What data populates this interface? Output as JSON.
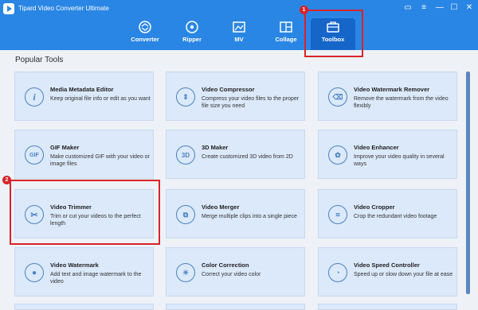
{
  "app": {
    "title": "Tipard Video Converter Ultimate"
  },
  "window_controls": [
    {
      "name": "feedback-icon",
      "glyph": "▭"
    },
    {
      "name": "menu-icon",
      "glyph": "≡"
    },
    {
      "name": "minimize-icon",
      "glyph": "—"
    },
    {
      "name": "maximize-icon",
      "glyph": "☐"
    },
    {
      "name": "close-icon",
      "glyph": "✕"
    }
  ],
  "nav": [
    {
      "label": "Converter",
      "icon": "converter-icon"
    },
    {
      "label": "Ripper",
      "icon": "ripper-icon"
    },
    {
      "label": "MV",
      "icon": "mv-icon"
    },
    {
      "label": "Collage",
      "icon": "collage-icon"
    },
    {
      "label": "Toolbox",
      "icon": "toolbox-icon",
      "active": true
    }
  ],
  "section_title": "Popular Tools",
  "tools": [
    {
      "title": "Media Metadata Editor",
      "desc": "Keep original file info or edit as you want",
      "icon": "info-icon",
      "glyph": "i"
    },
    {
      "title": "Video Compressor",
      "desc": "Compress your video files to the proper file size you need",
      "icon": "compress-icon",
      "glyph": "⇕"
    },
    {
      "title": "Video Watermark Remover",
      "desc": "Remove the watermark from the video flexibly",
      "icon": "eraser-icon",
      "glyph": "⌫"
    },
    {
      "title": "GIF Maker",
      "desc": "Make customized GIF with your video or image files",
      "icon": "gif-icon",
      "glyph": "GIF"
    },
    {
      "title": "3D Maker",
      "desc": "Create customized 3D video from 2D",
      "icon": "3d-icon",
      "glyph": "3D"
    },
    {
      "title": "Video Enhancer",
      "desc": "Improve your video quality in several ways",
      "icon": "palette-icon",
      "glyph": "✿"
    },
    {
      "title": "Video Trimmer",
      "desc": "Trim or cut your videos to the perfect length",
      "icon": "scissors-icon",
      "glyph": "✂"
    },
    {
      "title": "Video Merger",
      "desc": "Merge multiple clips into a single piece",
      "icon": "merge-icon",
      "glyph": "⧉"
    },
    {
      "title": "Video Cropper",
      "desc": "Crop the redundant video footage",
      "icon": "crop-icon",
      "glyph": "⌗"
    },
    {
      "title": "Video Watermark",
      "desc": "Add text and image watermark to the video",
      "icon": "drop-icon",
      "glyph": "💧"
    },
    {
      "title": "Color Correction",
      "desc": "Correct your video color",
      "icon": "sun-icon",
      "glyph": "☀"
    },
    {
      "title": "Video Speed Controller",
      "desc": "Speed up or slow down your file at ease",
      "icon": "speed-icon",
      "glyph": "◔"
    }
  ],
  "annotations": {
    "step1": "1",
    "step2": "2"
  },
  "colors": {
    "header": "#2a86e4",
    "active_tab": "#1665c9",
    "card": "#dbe9fa",
    "highlight": "#d8232a"
  }
}
